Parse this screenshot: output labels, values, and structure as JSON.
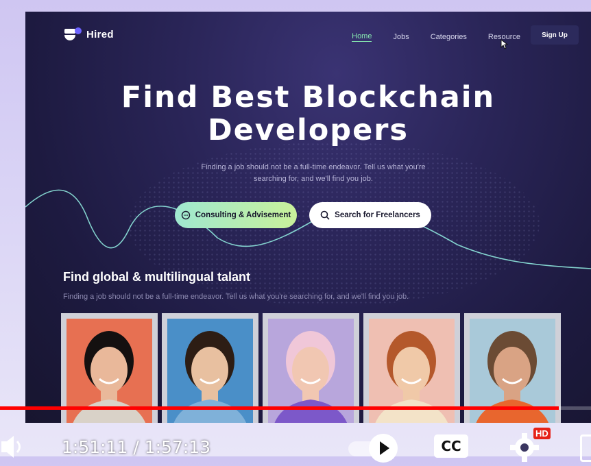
{
  "brand": {
    "name": "Hired"
  },
  "nav": {
    "items": [
      "Home",
      "Jobs",
      "Categories",
      "Resource"
    ],
    "active": "Home",
    "signup_label": "Sign Up"
  },
  "hero": {
    "headline_line1": "Find Best Blockchain",
    "headline_line2": "Developers",
    "sub_line1": "Finding a job should not be a full-time endeavor. Tell us what you're",
    "sub_line2": "searching for, and we'll find you job.",
    "cta_primary": "Consulting & Advisement",
    "cta_secondary": "Search for Freelancers"
  },
  "talent": {
    "title": "Find global & multilingual talant",
    "subtitle": "Finding a job should not be a full-time endeavor. Tell us what you're searching for, and we'll find you job.",
    "cards": [
      {
        "bg": "#e77052"
      },
      {
        "bg": "#4a8fc8"
      },
      {
        "bg": "#b8a6dc"
      },
      {
        "bg": "#efbfb2"
      },
      {
        "bg": "#a9c9d9"
      }
    ]
  },
  "player": {
    "time": "1:51:11 / 1:57:13",
    "progress": 0.946,
    "hd_badge": "HD",
    "cc_label": "CC",
    "icons": [
      "volume-icon",
      "play-icon",
      "captions-icon",
      "settings-icon",
      "fullscreen-icon"
    ]
  },
  "colors": {
    "accent_green": "#86e7b0",
    "progress_red": "#ff0000",
    "page_bg": "#1d1a40"
  }
}
